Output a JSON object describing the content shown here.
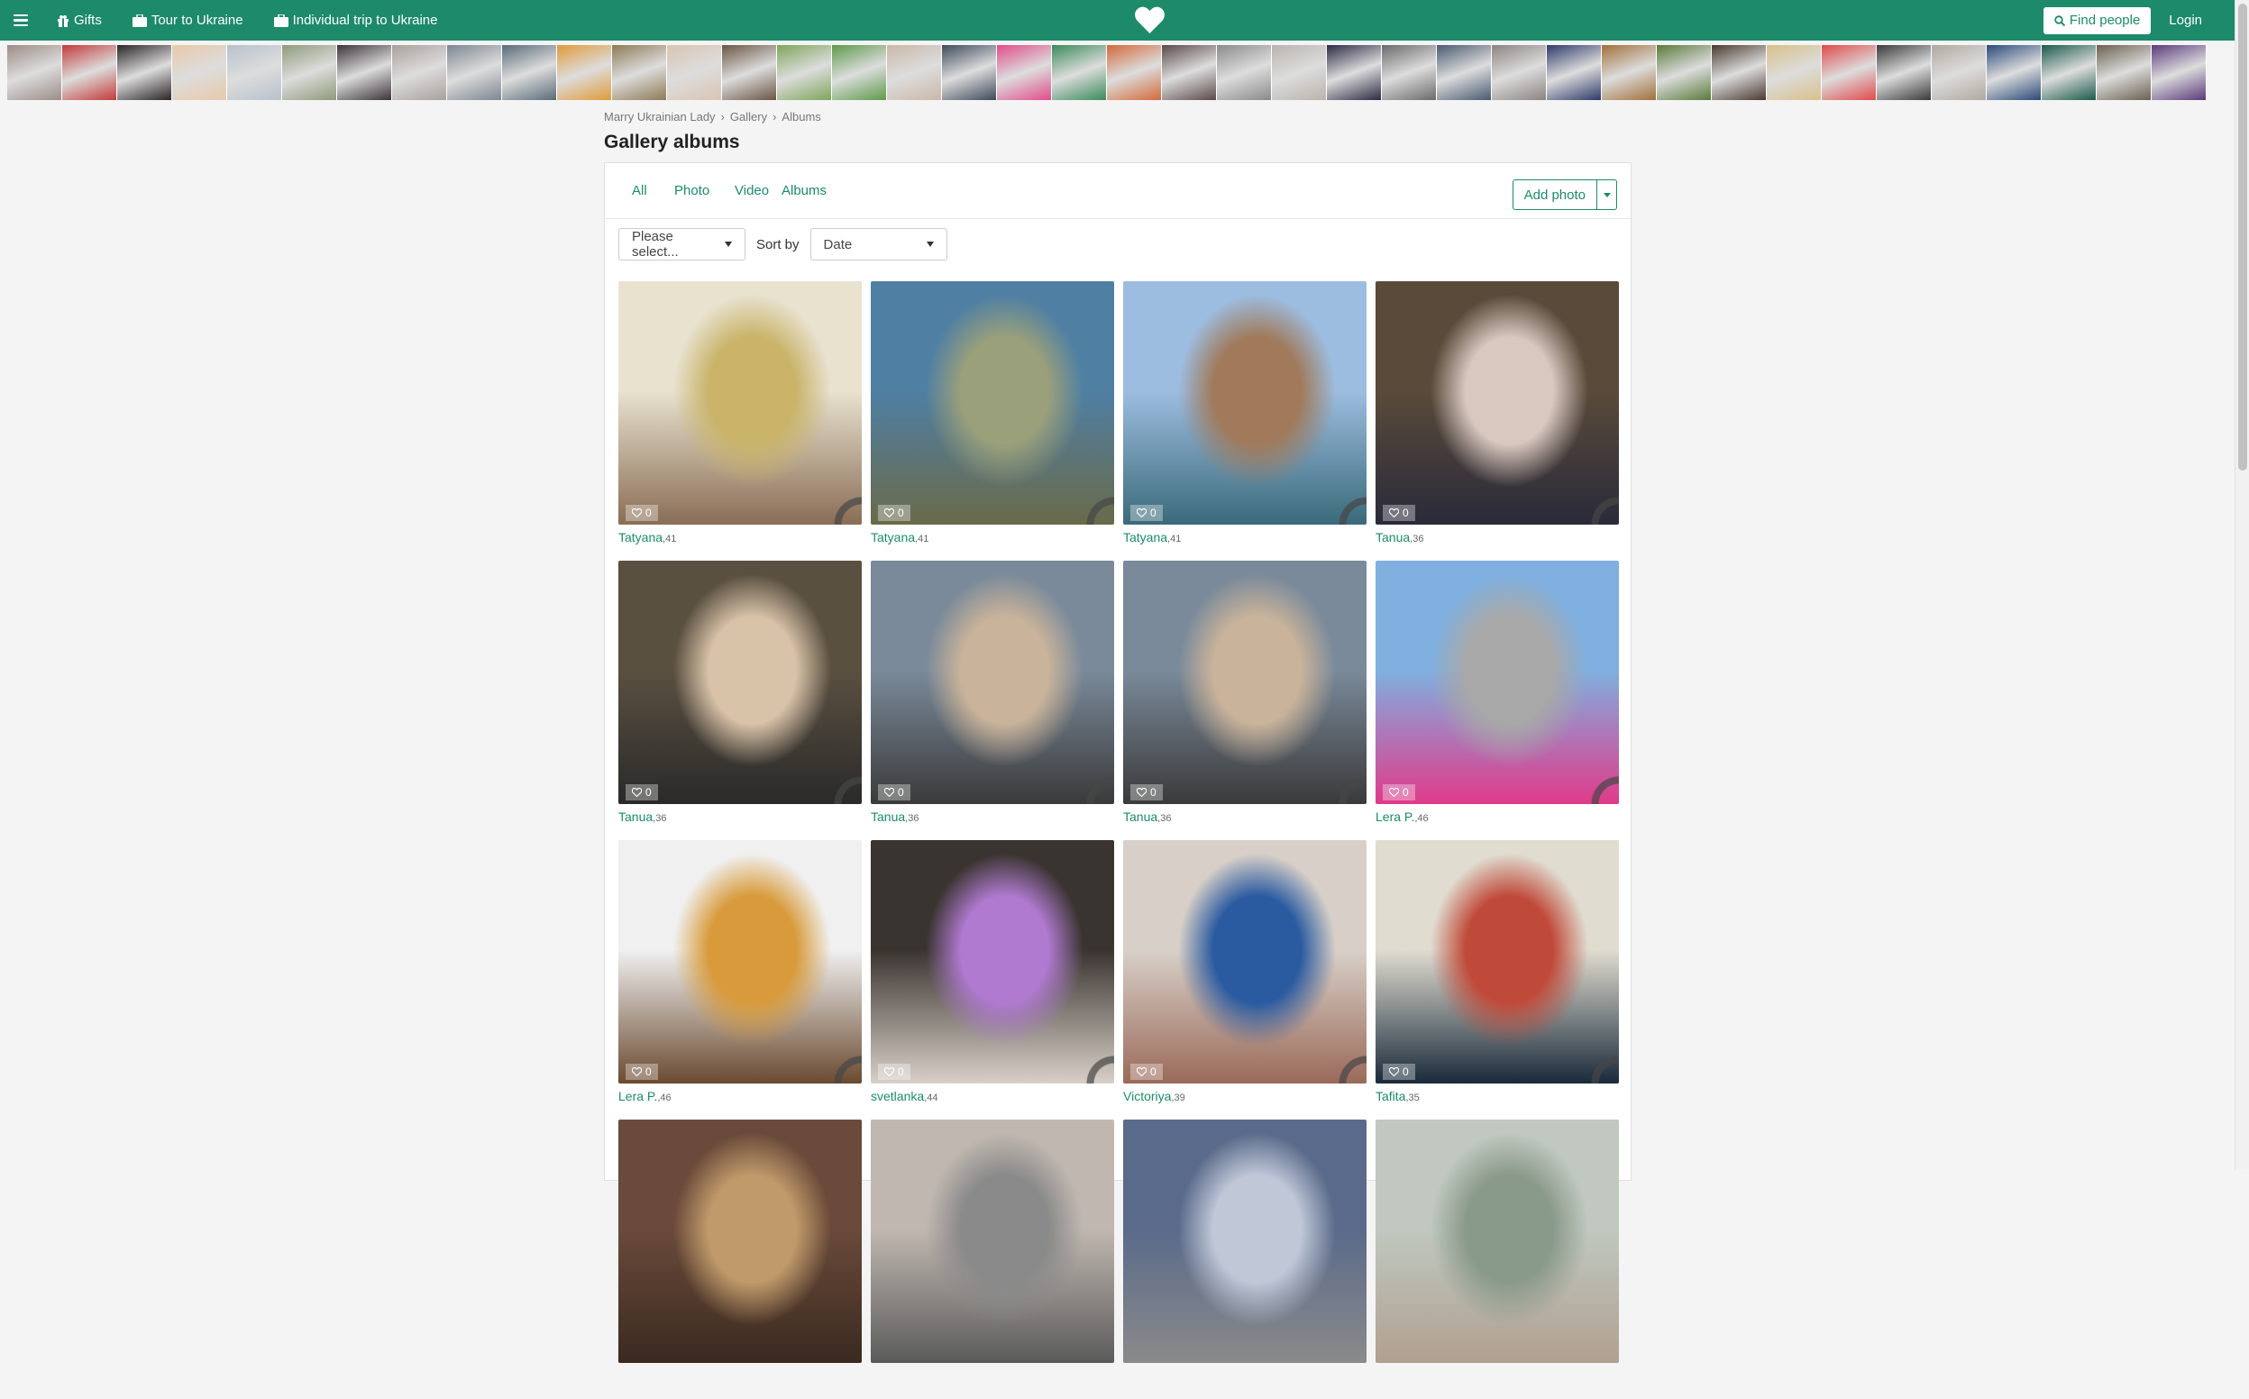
{
  "nav": {
    "gifts": "Gifts",
    "tour": "Tour to Ukraine",
    "trip": "Individual trip to Ukraine",
    "find_people": "Find people",
    "login": "Login"
  },
  "thumbnails": [
    "#9b8c86",
    "#c33a3a",
    "#2a2426",
    "#e8c9a8",
    "#b7c2cc",
    "#8d9a7a",
    "#3b3439",
    "#a8a09a",
    "#7c8690",
    "#5a6b78",
    "#e09a3a",
    "#8e7a56",
    "#d9c4b3",
    "#6a5544",
    "#7ea55a",
    "#5d9a4a",
    "#c9b8a8",
    "#3e4a5a",
    "#e04c8a",
    "#3a8a5a",
    "#d26a3a",
    "#5a4a48",
    "#8a8a8a",
    "#b9b3ac",
    "#2c2a44",
    "#6a6a6a",
    "#4a5a70",
    "#8a8480",
    "#2e3a6a",
    "#a0703a",
    "#5a7a3a",
    "#4a3a30",
    "#d8c08a",
    "#e04a4a",
    "#3a3a3a",
    "#b0a8a0",
    "#2a4a7a",
    "#1a5a4a",
    "#6a6050",
    "#5a3a7a"
  ],
  "breadcrumb": [
    "Marry Ukrainian Lady",
    "Gallery",
    "Albums"
  ],
  "page_title": "Gallery albums",
  "tabs": [
    "All",
    "Photo",
    "Video",
    "Albums"
  ],
  "add_photo": "Add photo",
  "filter": {
    "select_placeholder": "Please select...",
    "sort_label": "Sort by",
    "sort_value": "Date"
  },
  "cards": [
    {
      "name": "Tatyana",
      "age": ",41",
      "likes": "0",
      "colors": [
        "#e8e2cf",
        "#c9b46a",
        "#8a6d55"
      ]
    },
    {
      "name": "Tatyana",
      "age": ",41",
      "likes": "0",
      "colors": [
        "#4f7fa3",
        "#9aa07a",
        "#6a6a4a"
      ]
    },
    {
      "name": "Tatyana",
      "age": ",41",
      "likes": "0",
      "colors": [
        "#9dbde0",
        "#a07a5a",
        "#3a6a7a"
      ]
    },
    {
      "name": "Tanua",
      "age": ",36",
      "likes": "0",
      "colors": [
        "#5a4a3a",
        "#d8c8c0",
        "#2a2a3a"
      ]
    },
    {
      "name": "Tanua",
      "age": ",36",
      "likes": "0",
      "colors": [
        "#5a5040",
        "#d8c2a8",
        "#2a2a2a"
      ]
    },
    {
      "name": "Tanua",
      "age": ",36",
      "likes": "0",
      "colors": [
        "#7a8a9a",
        "#c9b39a",
        "#3a3a3a"
      ]
    },
    {
      "name": "Tanua",
      "age": ",36",
      "likes": "0",
      "colors": [
        "#7a8a9a",
        "#c9b39a",
        "#3a3a3a"
      ]
    },
    {
      "name": "Lera P.",
      "age": ",46",
      "likes": "0",
      "colors": [
        "#7fb0e0",
        "#a8a8a8",
        "#e03a8a"
      ]
    },
    {
      "name": "Lera P.",
      "age": ",46",
      "likes": "0",
      "colors": [
        "#f0f0f0",
        "#d89a3a",
        "#6a4a30"
      ]
    },
    {
      "name": "svetlanka",
      "age": ",44",
      "likes": "0",
      "colors": [
        "#3a3430",
        "#b07ad0",
        "#d8d0c8"
      ]
    },
    {
      "name": "Victoriya",
      "age": ",39",
      "likes": "0",
      "colors": [
        "#d8d0c8",
        "#2a5aa0",
        "#9a6a5a"
      ]
    },
    {
      "name": "Tafita",
      "age": ",35",
      "likes": "0",
      "colors": [
        "#e0dcd0",
        "#c04a3a",
        "#1a2a3a"
      ]
    },
    {
      "name": "",
      "age": "",
      "likes": "",
      "colors": [
        "#6a4a3a",
        "#c09a6a",
        "#3a2a20"
      ]
    },
    {
      "name": "",
      "age": "",
      "likes": "",
      "colors": [
        "#c0b8b0",
        "#8a8a8a",
        "#5a5a5a"
      ]
    },
    {
      "name": "",
      "age": "",
      "likes": "",
      "colors": [
        "#5a6a8a",
        "#c0c8d8",
        "#8a8a8a"
      ]
    },
    {
      "name": "",
      "age": "",
      "likes": "",
      "colors": [
        "#c0c8c0",
        "#8a9a8a",
        "#b0a090"
      ]
    }
  ],
  "colors": {
    "brand": "#1d8a6a",
    "link": "#1a8c6b"
  }
}
